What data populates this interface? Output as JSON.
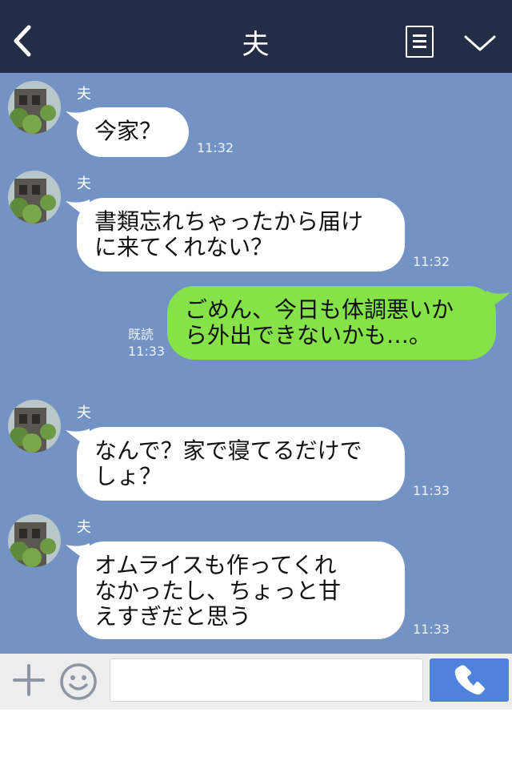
{
  "header": {
    "title": "夫",
    "back_icon": "chevron-left-icon",
    "menu_icon": "list-icon",
    "collapse_icon": "chevron-down-icon",
    "background": "#232d45"
  },
  "chat": {
    "background": "#7293c4",
    "messages": [
      {
        "direction": "incoming",
        "sender": "夫",
        "text": "今家？",
        "time": "11:32"
      },
      {
        "direction": "incoming",
        "sender": "夫",
        "text": "書類忘れちゃったから届け\nに来てくれない？",
        "time": "11:32"
      },
      {
        "direction": "outgoing",
        "text": "ごめん、今日も体調悪いか\nら外出できないかも…。",
        "read_label": "既読",
        "time": "11:33"
      },
      {
        "direction": "incoming",
        "sender": "夫",
        "text": "なんで？家で寝てるだけで\nしょ？",
        "time": "11:33"
      },
      {
        "direction": "incoming",
        "sender": "夫",
        "text": "オムライスも作ってくれ\nなかったし、ちょっと甘\nえすぎだと思う",
        "time": "11:33"
      }
    ]
  },
  "input_bar": {
    "plus_icon": "plus-icon",
    "emoji_icon": "smiley-icon",
    "text_value": "",
    "call_icon": "phone-icon",
    "call_color": "#4f82dc"
  }
}
